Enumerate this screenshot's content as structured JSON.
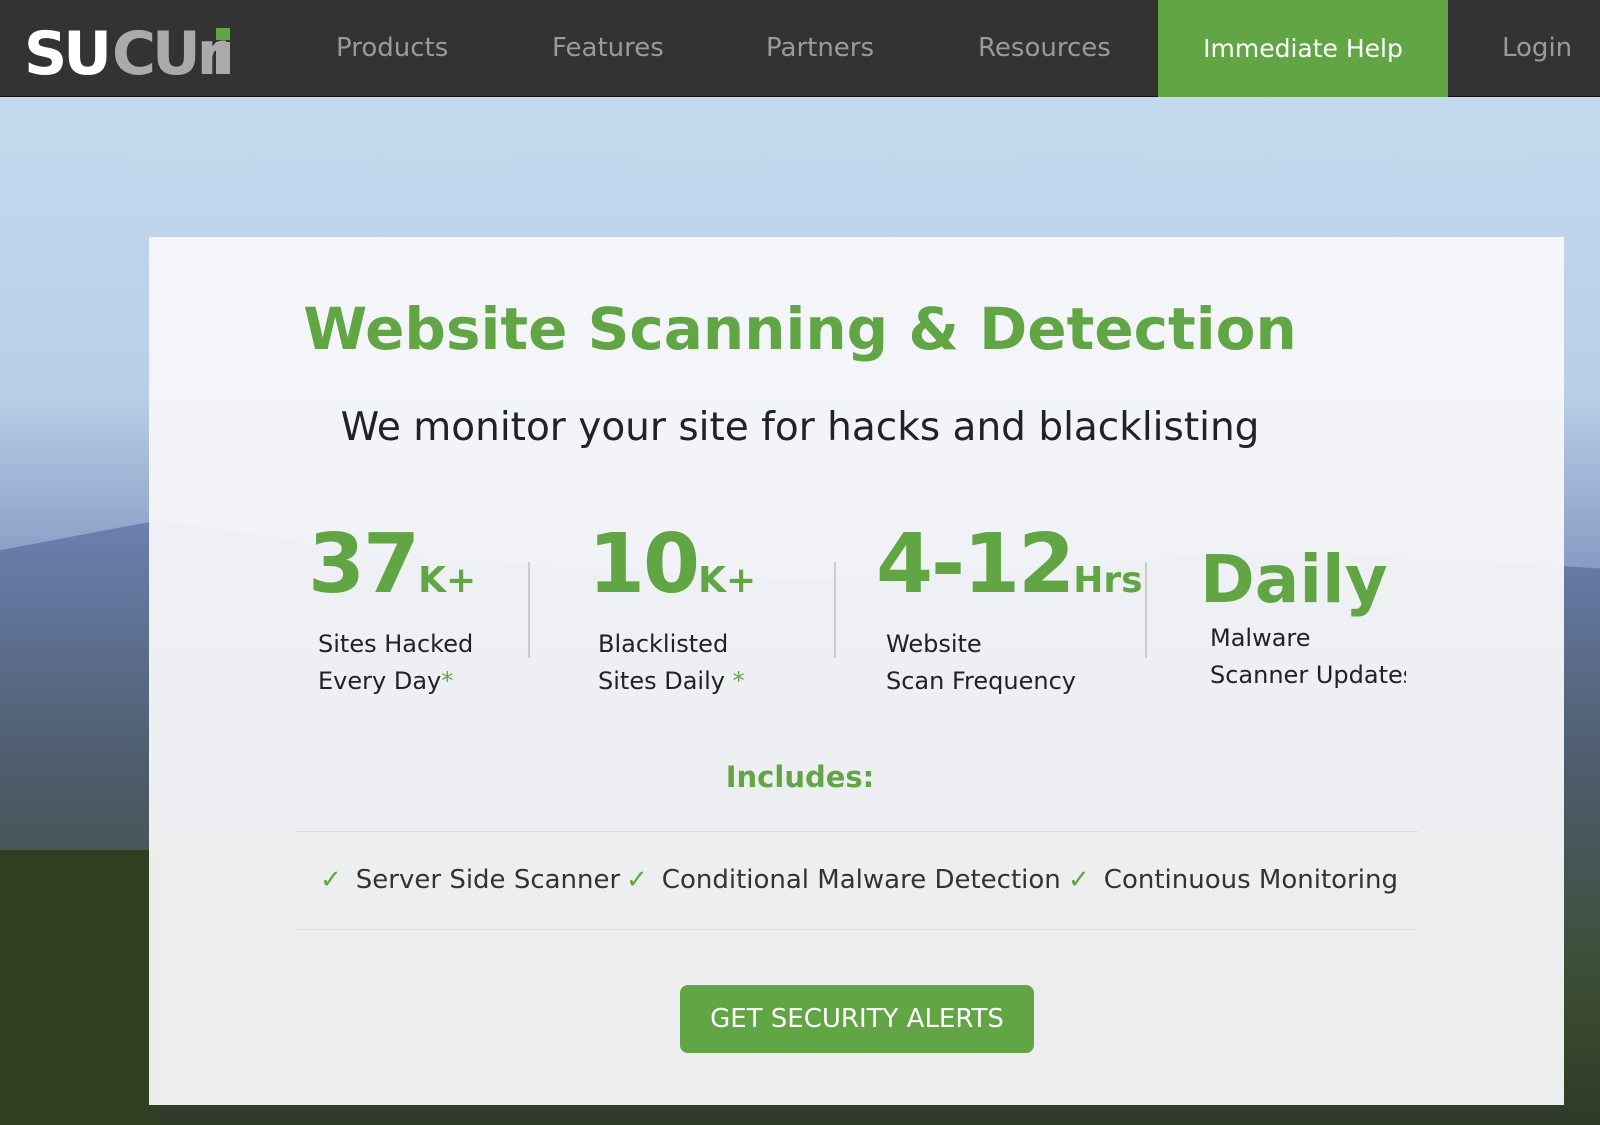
{
  "nav": {
    "logo": "sucuri",
    "items": [
      "Products",
      "Features",
      "Partners",
      "Resources"
    ],
    "help": "Immediate Help",
    "login": "Login"
  },
  "colors": {
    "accent": "#61a544",
    "nav_bg": "#333333"
  },
  "hero": {
    "title": "Website Scanning & Detection",
    "subtitle": "We monitor your site for hacks and blacklisting"
  },
  "stats": [
    {
      "value": "37",
      "suffix": "K+",
      "line1": "Sites Hacked",
      "line2": "Every Day",
      "asterisk": "*"
    },
    {
      "value": "10",
      "suffix": "K+",
      "line1": "Blacklisted",
      "line2": "Sites Daily",
      "asterisk": " *"
    },
    {
      "value": "4-12",
      "suffix": "Hrs",
      "line1": "Website",
      "line2": "Scan Frequency",
      "asterisk": ""
    },
    {
      "value": "Daily",
      "suffix": "",
      "line1": "Malware",
      "line2": "Scanner Updates",
      "asterisk": ""
    }
  ],
  "includes": {
    "label": "Includes:",
    "items": [
      "Server Side Scanner",
      "Conditional Malware Detection",
      "Continuous Monitoring"
    ]
  },
  "cta": "GET SECURITY ALERTS"
}
